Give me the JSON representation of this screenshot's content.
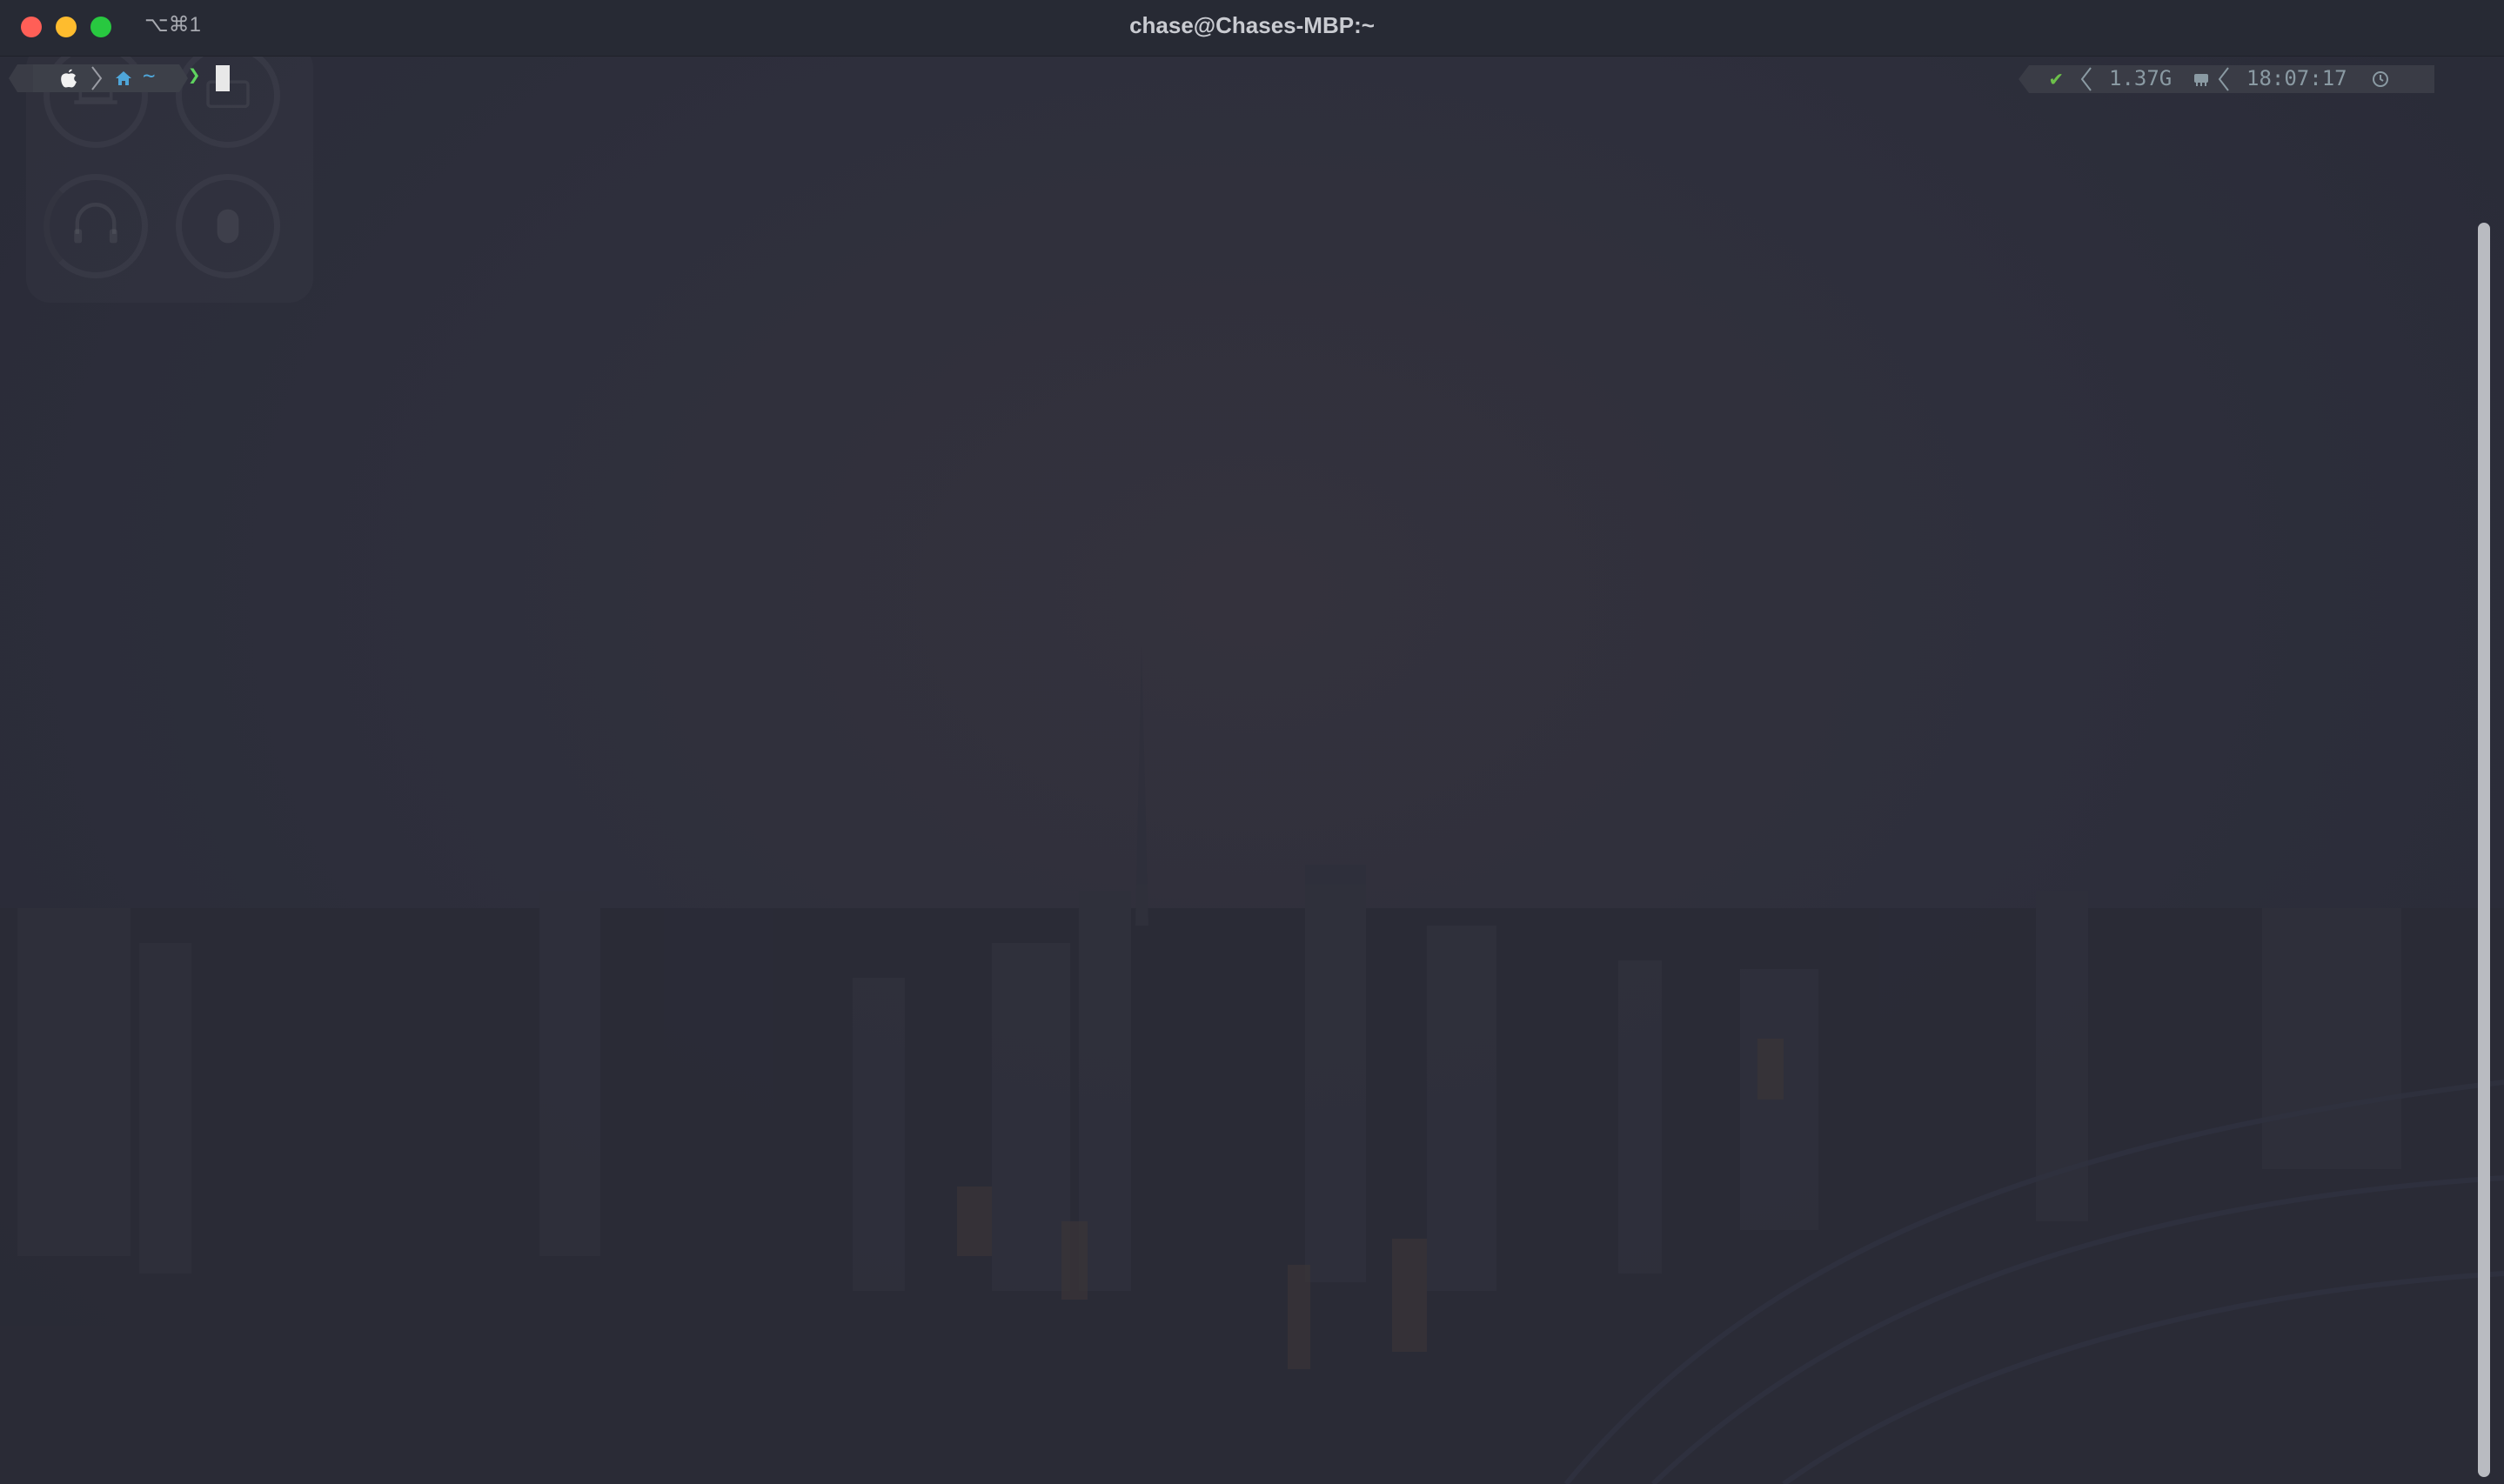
{
  "window": {
    "title": "chase@Chases-MBP:~",
    "shortcut": "⌥⌘1"
  },
  "prompt": {
    "os_icon": "apple-icon",
    "dir_icon": "home-icon",
    "directory": "~",
    "prompt_symbol": "❯",
    "input": ""
  },
  "right_prompt": {
    "status_icon": "check-icon",
    "status_symbol": "✔",
    "memory": "1.37G",
    "memory_icon": "ram-icon",
    "time": "18:07:17",
    "clock_icon": "clock-icon"
  },
  "widget": {
    "rings": [
      "laptop-icon",
      "keyboard-icon",
      "headphones-icon",
      "mouse-icon"
    ]
  },
  "colors": {
    "background": "#2b2d3a",
    "titlebar": "#272a34",
    "directory": "#4fa6d9",
    "prompt_ok": "#5fd35f",
    "right_prompt_text": "#8a9aa3",
    "status_ok": "#6cc04a",
    "close": "#ff5f57",
    "minimize": "#febc2e",
    "zoom": "#28c840"
  }
}
